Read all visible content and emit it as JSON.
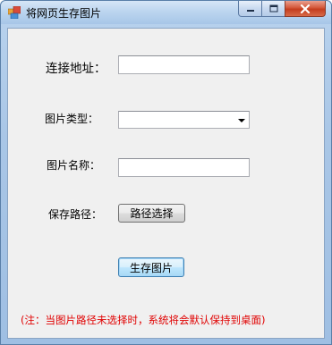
{
  "window": {
    "title": "将网页生存图片"
  },
  "form": {
    "url_label": "连接地址：",
    "url_value": "",
    "type_label": "图片类型：",
    "type_value": "",
    "name_label": "图片名称：",
    "name_value": "",
    "path_label": "保存路径：",
    "path_button": "路径选择",
    "generate_button": "生存图片"
  },
  "note": "(注：当图片路径未选择时，系统将会默认保持到桌面)"
}
